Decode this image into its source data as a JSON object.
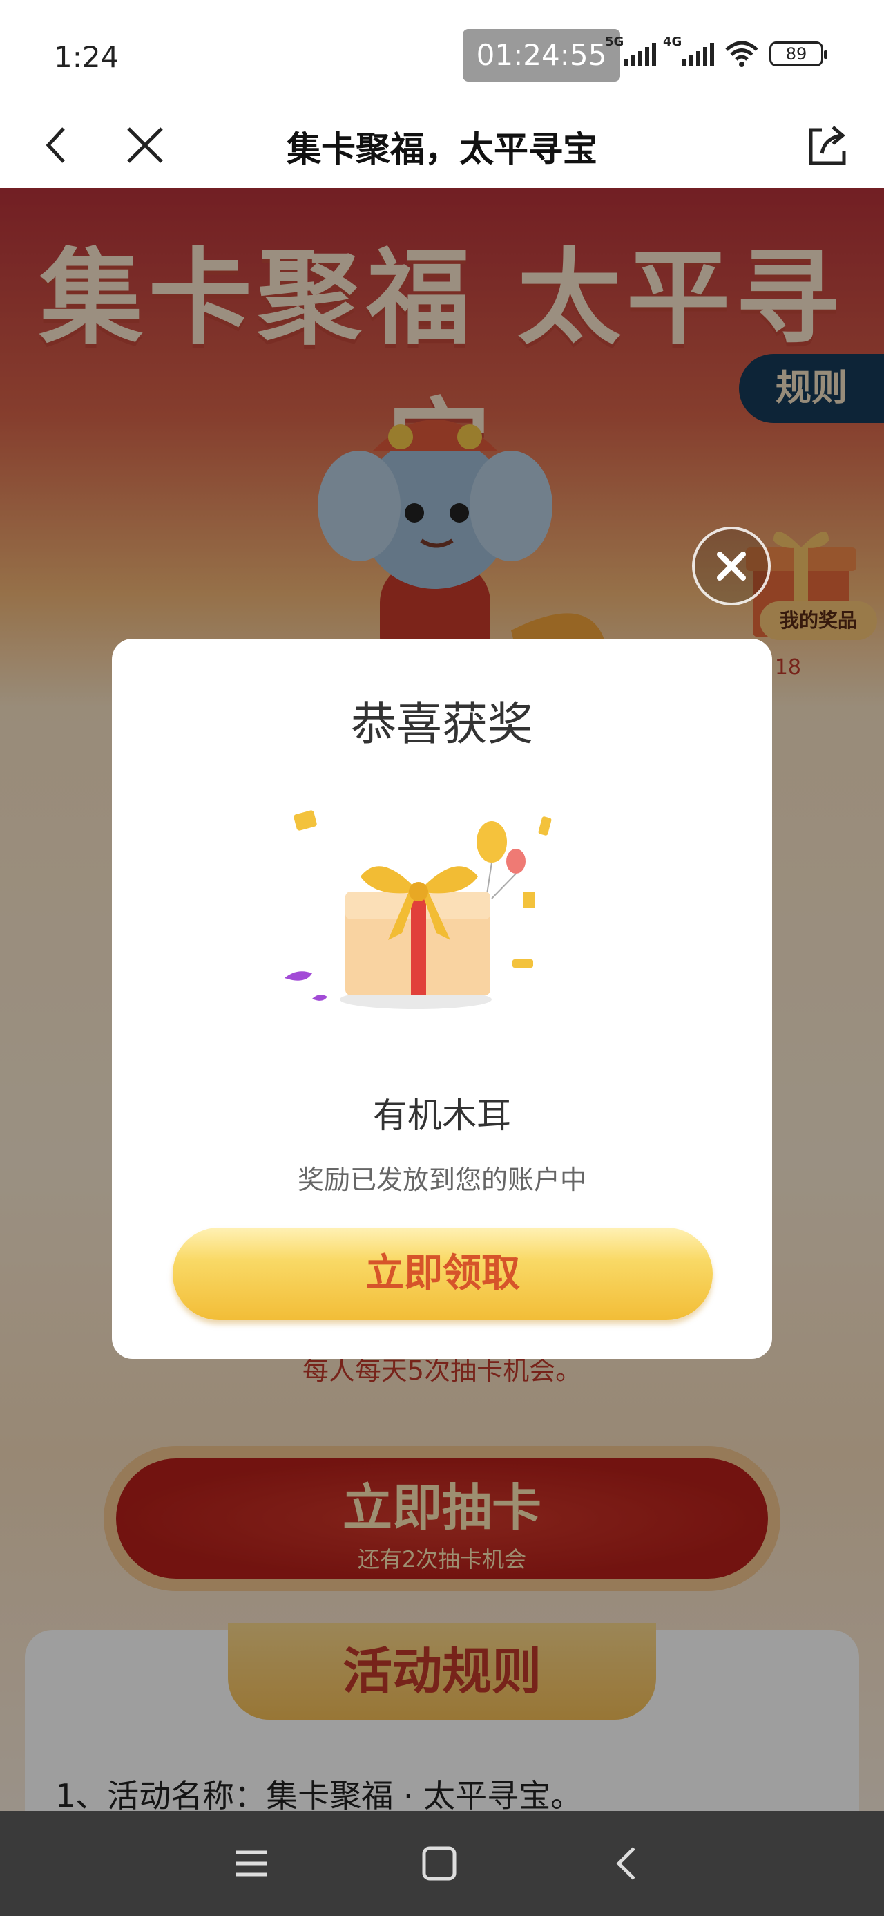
{
  "status_bar": {
    "time": "1:24",
    "clock_overlay": "01:24:55",
    "network_1": "5G",
    "network_2": "4G",
    "battery": "89"
  },
  "nav": {
    "title": "集卡聚福，太平寻宝",
    "back_icon": "back-chevron-icon",
    "close_icon": "close-icon",
    "share_icon": "share-icon"
  },
  "page": {
    "hero_title": "集卡聚福 太平寻宝",
    "rules_tab": "规则",
    "my_prize": "我的奖品",
    "count_badge": "18",
    "chance_text": "每人每天5次抽卡机会。",
    "draw_button": "立即抽卡",
    "draw_button_sub": "还有2次抽卡机会",
    "rules_heading": "活动规则",
    "rules_line_1": "1、活动名称：集卡聚福 · 太平寻宝。"
  },
  "modal": {
    "title": "恭喜获奖",
    "prize_name": "有机木耳",
    "prize_desc": "奖励已发放到您的账户中",
    "claim_button": "立即领取",
    "close_icon": "close-circle-icon"
  },
  "colors": {
    "accent_red": "#c0392b",
    "button_gold": "#f9d966",
    "button_text": "#d6542a",
    "rules_tab_bg": "#153a5a"
  },
  "system_nav": {
    "menu_icon": "menu-icon",
    "home_icon": "home-square-icon",
    "back_icon": "back-triangle-icon"
  }
}
